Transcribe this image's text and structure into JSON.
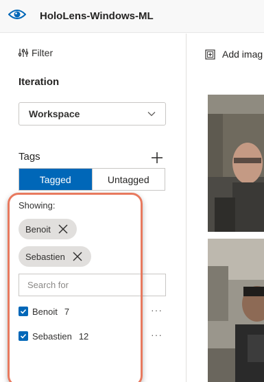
{
  "header": {
    "app_title": "HoloLens-Windows-ML",
    "logo_icon": "eye-icon"
  },
  "sidebar": {
    "filter_label": "Filter",
    "iteration": {
      "title": "Iteration",
      "selected": "Workspace"
    },
    "tags": {
      "title": "Tags",
      "toggle": {
        "tagged": "Tagged",
        "untagged": "Untagged",
        "active": "Tagged"
      },
      "showing_label": "Showing:",
      "active_filters": [
        {
          "label": "Benoit"
        },
        {
          "label": "Sebastien"
        }
      ],
      "search_placeholder": "Search for",
      "list": [
        {
          "name": "Benoit",
          "count": "7",
          "checked": true,
          "more": "···"
        },
        {
          "name": "Sebastien",
          "count": "12",
          "checked": true,
          "more": "···"
        }
      ]
    }
  },
  "main": {
    "add_images_label": "Add imag"
  },
  "colors": {
    "accent": "#0067b8",
    "highlight": "#e8795e",
    "chip": "#e1dfdd"
  }
}
